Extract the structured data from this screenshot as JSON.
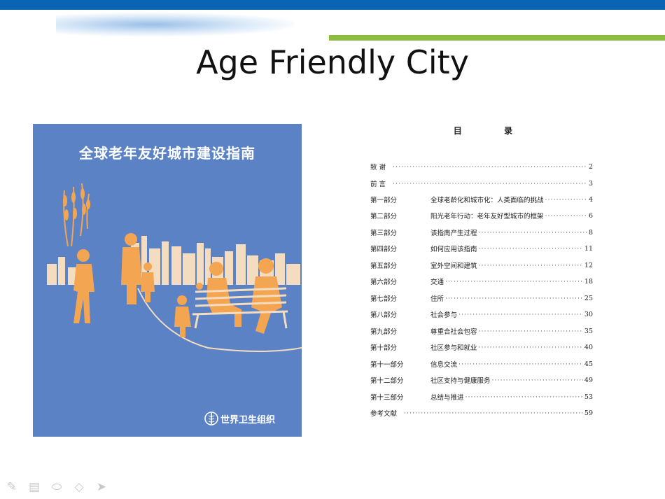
{
  "slide": {
    "title": "Age Friendly City"
  },
  "cover": {
    "title": "全球老年友好城市建设指南",
    "publisher": "世界卫生组织",
    "colors": {
      "background": "#5b82c4",
      "figures": "#f4a552",
      "skyline": "#f4dcc0"
    }
  },
  "toc": {
    "heading": "目 录",
    "entries": [
      {
        "part": "致 谢",
        "title": "",
        "page": "2"
      },
      {
        "part": "前 言",
        "title": "",
        "page": "3"
      },
      {
        "part": "第一部分",
        "title": "全球老龄化和城市化：人类面临的挑战",
        "page": "4"
      },
      {
        "part": "第二部分",
        "title": "阳光老年行动：老年友好型城市的框架",
        "page": "6"
      },
      {
        "part": "第三部分",
        "title": "该指南产生过程",
        "page": "8"
      },
      {
        "part": "第四部分",
        "title": "如何应用该指南",
        "page": "11"
      },
      {
        "part": "第五部分",
        "title": "室外空间和建筑",
        "page": "12"
      },
      {
        "part": "第六部分",
        "title": "交通",
        "page": "18"
      },
      {
        "part": "第七部分",
        "title": "住所",
        "page": "25"
      },
      {
        "part": "第八部分",
        "title": "社会参与",
        "page": "30"
      },
      {
        "part": "第九部分",
        "title": "尊重合社会包容",
        "page": "35"
      },
      {
        "part": "第十部分",
        "title": "社区参与和就业",
        "page": "40"
      },
      {
        "part": "第十一部分",
        "title": "信息交流",
        "page": "45"
      },
      {
        "part": "第十二部分",
        "title": "社区支持与健康服务",
        "page": "49"
      },
      {
        "part": "第十三部分",
        "title": "总结与推进",
        "page": "53"
      },
      {
        "part": "参考文献",
        "title": "",
        "page": "59"
      }
    ]
  },
  "toolbar": {
    "tools": [
      "pen-icon",
      "slides-icon",
      "eraser-icon",
      "highlighter-icon",
      "pointer-icon"
    ]
  },
  "colors": {
    "top_bar": "#0b63b3",
    "accent_green": "#8cbc3f"
  }
}
